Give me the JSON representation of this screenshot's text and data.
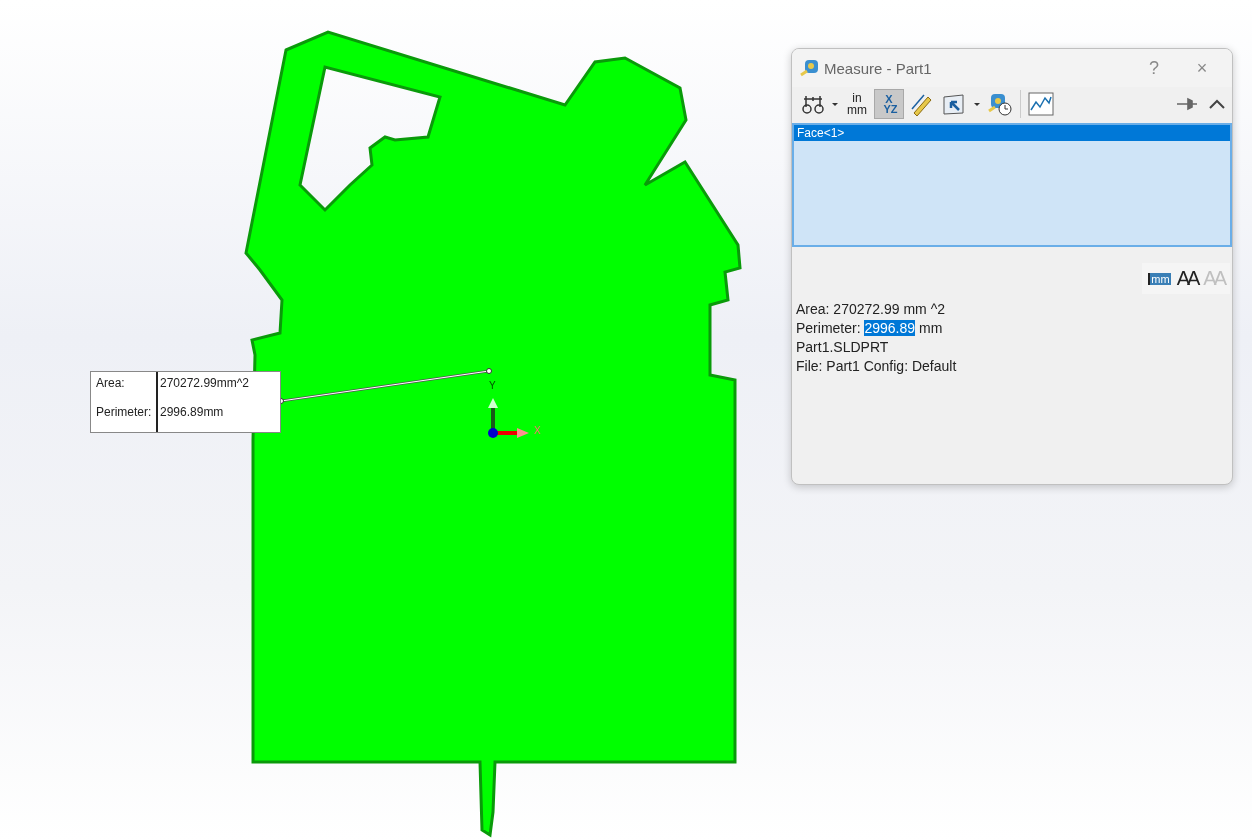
{
  "viewport": {
    "triad": {
      "x_label": "X",
      "y_label": "Y"
    },
    "callout": {
      "rows": [
        {
          "label": "Area:",
          "value": "270272.99mm^2"
        },
        {
          "label": "Perimeter:",
          "value": "2996.89mm"
        }
      ]
    }
  },
  "dialog": {
    "title": "Measure - Part1",
    "help": "?",
    "close": "×",
    "toolbar": [
      {
        "kind": "arc",
        "selected": false
      },
      {
        "kind": "caret"
      },
      {
        "kind": "units",
        "top": "in",
        "bottom": "mm",
        "selected": false
      },
      {
        "kind": "xyz",
        "letters": [
          "X",
          "Y",
          "Z"
        ],
        "selected": true
      },
      {
        "kind": "ruler",
        "selected": false
      },
      {
        "kind": "projection",
        "selected": false
      },
      {
        "kind": "caret"
      },
      {
        "kind": "history",
        "selected": false
      },
      {
        "kind": "sensor",
        "selected": false
      }
    ],
    "selection": [
      {
        "label": "Face<1>",
        "selected": true
      }
    ],
    "format_tools": [
      {
        "kind": "precision",
        "text": "mm",
        "disabled": false
      },
      {
        "kind": "font-up",
        "text": "AA",
        "disabled": false
      },
      {
        "kind": "font-down",
        "text": "AA",
        "disabled": true
      }
    ],
    "results": [
      {
        "label": "Area:",
        "value": "270272.99",
        "unit": "mm ^2",
        "highlighted": false
      },
      {
        "label": "Perimeter:",
        "value": "2996.89",
        "unit": "mm",
        "highlighted": true
      },
      {
        "text": "Part1.SLDPRT"
      },
      {
        "text": "File: Part1 Config: Default"
      }
    ]
  }
}
